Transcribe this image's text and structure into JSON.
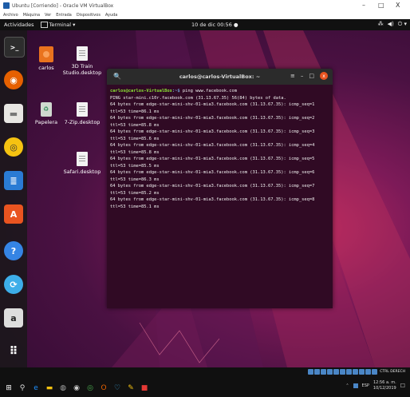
{
  "host": {
    "title": "Ubuntu [Corriendo] - Oracle VM VirtualBox",
    "menu": [
      "Archivo",
      "Máquina",
      "Ver",
      "Entrada",
      "Dispositivos",
      "Ayuda"
    ],
    "window_controls": {
      "minimize": "–",
      "maximize": "□",
      "close": "X"
    }
  },
  "topbar": {
    "activities": "Actividades",
    "app_menu": "Terminal ▾",
    "clock": "10 de dic 00:56 ●",
    "tray": {
      "network": "⁂",
      "volume": "◀)",
      "power": "⏻ ▾"
    }
  },
  "desktop_icons": [
    {
      "label": "carlos",
      "kind": "folder"
    },
    {
      "label": "3D Train Studio.desktop",
      "kind": "file"
    },
    {
      "label": "Papelera",
      "kind": "trash"
    },
    {
      "label": "7-Zip.desktop",
      "kind": "file"
    },
    {
      "label": "Safari.desktop",
      "kind": "file"
    }
  ],
  "dock": [
    {
      "name": "terminal",
      "glyph": ">_",
      "color": "#2d2d2d"
    },
    {
      "name": "firefox",
      "glyph": "◉",
      "color": "#e66000"
    },
    {
      "name": "files",
      "glyph": "▬",
      "color": "#e8e6e3"
    },
    {
      "name": "rhythmbox",
      "glyph": "◎",
      "color": "#f5c211"
    },
    {
      "name": "writer",
      "glyph": "≣",
      "color": "#2a7bd4"
    },
    {
      "name": "software",
      "glyph": "A",
      "color": "#e95420"
    },
    {
      "name": "help",
      "glyph": "?",
      "color": "#3584e4"
    },
    {
      "name": "updater",
      "glyph": "⟳",
      "color": "#3daee9"
    },
    {
      "name": "amazon",
      "glyph": "a",
      "color": "#dddddd"
    },
    {
      "name": "show-apps",
      "glyph": "⠿",
      "color": "transparent"
    }
  ],
  "terminal": {
    "title": "carlos@carlos-VirtualBox: ~",
    "controls": {
      "search": "🔍",
      "menu": "≡",
      "minimize": "–",
      "maximize": "□",
      "close": "x"
    },
    "prompt_user": "carlos@carlos-VirtualBox",
    "prompt_path": ":~$",
    "command": " ping www.facebook.com",
    "lines": [
      "PING star-mini.c10r.facebook.com (31.13.67.35) 56(84) bytes of data.",
      "64 bytes from edge-star-mini-shv-01-mia3.facebook.com (31.13.67.35): icmp_seq=1",
      "ttl=53 time=86.1 ms",
      "64 bytes from edge-star-mini-shv-01-mia3.facebook.com (31.13.67.35): icmp_seq=2",
      "ttl=53 time=85.8 ms",
      "64 bytes from edge-star-mini-shv-01-mia3.facebook.com (31.13.67.35): icmp_seq=3",
      "ttl=53 time=85.6 ms",
      "64 bytes from edge-star-mini-shv-01-mia3.facebook.com (31.13.67.35): icmp_seq=4",
      "ttl=53 time=85.8 ms",
      "64 bytes from edge-star-mini-shv-01-mia3.facebook.com (31.13.67.35): icmp_seq=5",
      "ttl=53 time=85.5 ms",
      "64 bytes from edge-star-mini-shv-01-mia3.facebook.com (31.13.67.35): icmp_seq=6",
      "ttl=53 time=86.3 ms",
      "64 bytes from edge-star-mini-shv-01-mia3.facebook.com (31.13.67.35): icmp_seq=7",
      "ttl=53 time=85.2 ms",
      "64 bytes from edge-star-mini-shv-01-mia3.facebook.com (31.13.67.35): icmp_seq=8",
      "ttl=53 time=85.1 ms"
    ]
  },
  "taskbar": {
    "vbox_strip_label": "CTRL DERECH",
    "tray_lang": "ESP",
    "time": "12:56 a. m.",
    "date": "10/12/2019"
  }
}
